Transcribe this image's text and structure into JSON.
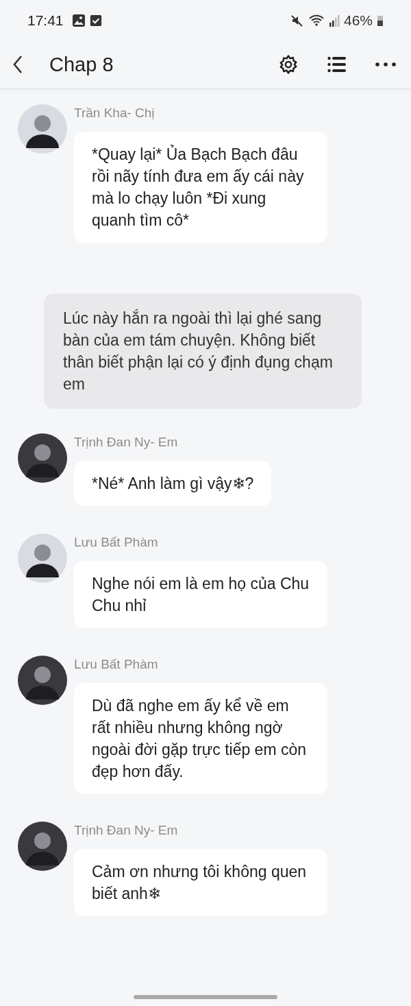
{
  "status_bar": {
    "time": "17:41",
    "battery": "46%"
  },
  "header": {
    "title": "Chap 8"
  },
  "messages": [
    {
      "kind": "character",
      "name": "Trần Kha- Chị",
      "text": "*Quay lại* Ủa Bạch Bạch đâu rồi nãy tính đưa em ấy cái này mà lo chạy luôn *Đi xung quanh tìm cô*"
    },
    {
      "kind": "narration",
      "text": "Lúc này hắn ra ngoài thì lại ghé sang bàn của em tám chuyện. Không biết thân biết phận lại có ý định đụng chạm em"
    },
    {
      "kind": "character",
      "name": "Trịnh Đan Ny- Em",
      "text": "*Né* Anh làm gì vậy❄?"
    },
    {
      "kind": "character",
      "name": "Lưu Bất Phàm",
      "text": "Nghe nói em là em họ của Chu Chu nhỉ"
    },
    {
      "kind": "character",
      "name": "Lưu Bất Phàm",
      "text": "Dù đã nghe em ấy kể về em rất nhiều nhưng không ngờ ngoài đời gặp trực tiếp em còn đẹp hơn đấy."
    },
    {
      "kind": "character",
      "name": "Trịnh Đan Ny- Em",
      "text": "Cảm ơn nhưng tôi không quen biết anh❄"
    }
  ]
}
